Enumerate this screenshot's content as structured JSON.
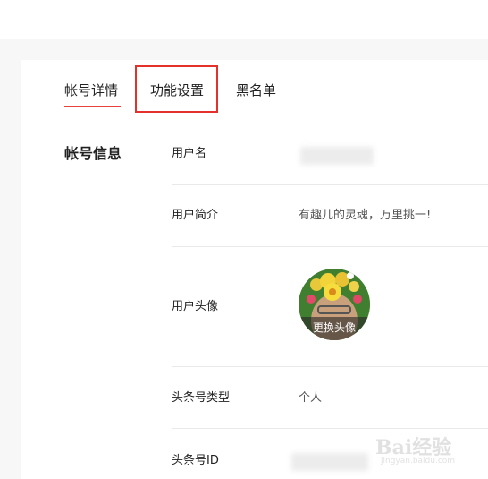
{
  "tabs": [
    {
      "label": "帐号详情",
      "active": true
    },
    {
      "label": "功能设置",
      "highlighted": true
    },
    {
      "label": "黑名单"
    }
  ],
  "section_title": "帐号信息",
  "rows": {
    "username": {
      "label": "用户名",
      "value": ""
    },
    "bio": {
      "label": "用户简介",
      "value": "有趣儿的灵魂，万里挑一!"
    },
    "avatar": {
      "label": "用户头像",
      "change_label": "更换头像"
    },
    "type": {
      "label": "头条号类型",
      "value": "个人"
    },
    "id": {
      "label": "头条号ID",
      "value": ""
    }
  },
  "watermark": {
    "brand": "Bai经验",
    "url": "jingyan.baidu.com"
  },
  "colors": {
    "accent": "#e8413d",
    "highlight_box": "#e4312b",
    "divider": "#e9e9e9"
  }
}
